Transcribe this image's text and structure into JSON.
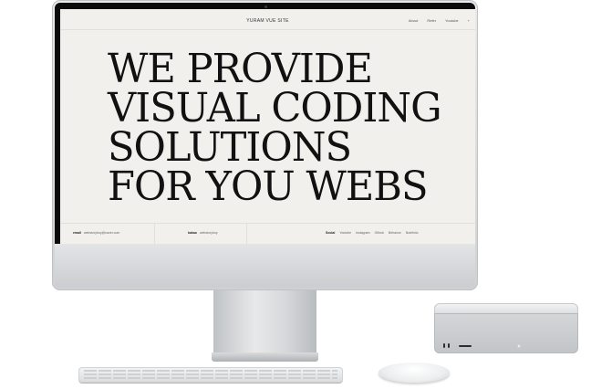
{
  "site": {
    "title": "YURAM VUE SITE",
    "nav": [
      "About",
      "Refer",
      "Youtube",
      "+"
    ]
  },
  "hero": {
    "lines": [
      "WE PROVIDE",
      "VISUAL CODING",
      "SOLUTIONS",
      "FOR YOU WEBS"
    ]
  },
  "footer": {
    "email_label": "email",
    "email_value": "webstoryboy@naver.com",
    "kakao_label": "kakao",
    "kakao_value": "webstoryboy",
    "social_label": "Social",
    "social_links": [
      "Youtube",
      "Instagram",
      "Github",
      "Behance",
      "Notefolio"
    ]
  },
  "colors": {
    "screen_bg": "#f1f0ec",
    "hero_text": "#111111",
    "device_silver": "#d4d6d8"
  }
}
